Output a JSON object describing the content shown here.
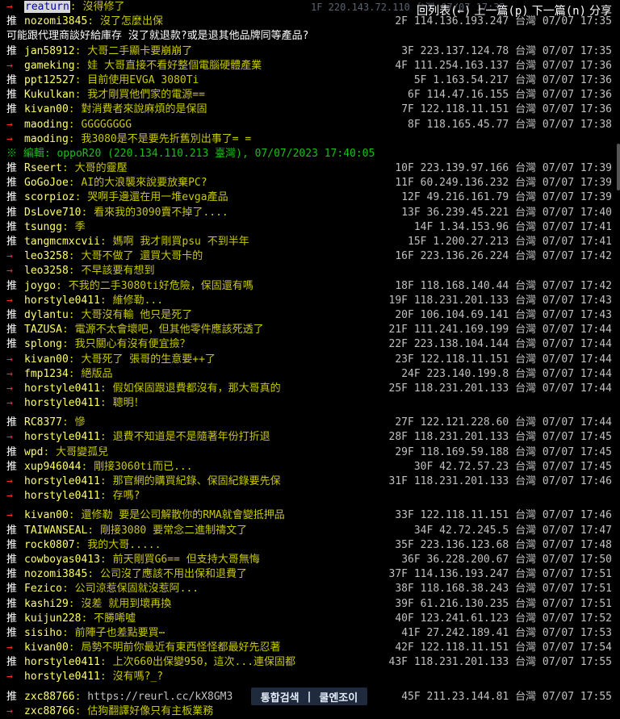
{
  "nav": {
    "back": "回列表(←)",
    "prev": "上一篇(p)",
    "next": "下一篇(n)",
    "share": "分享"
  },
  "faded_header": "1F 220.143.72.110 台灣 07/07 17:35",
  "body_line": "可能跟代理商談好給庫存 沒了就退款?或是退其他品牌同等產品?",
  "edit_line": "※ 編輯: oppoR20 (220.134.110.213 臺灣), 07/07/2023 17:40:05",
  "comments_a": [
    {
      "tag": "→",
      "type": "arrow",
      "user": "reaturn",
      "hl": true,
      "content": "沒得修了",
      "meta": ""
    },
    {
      "tag": "推",
      "type": "push",
      "user": "nozomi3845",
      "content": "沒了怎麼出保",
      "meta": "2F 114.136.193.247 台灣 07/07 17:35"
    }
  ],
  "comments_b": [
    {
      "tag": "推",
      "type": "push",
      "user": "jan58912",
      "content": "大哥二手顯卡要崩崩了",
      "meta": "3F 223.137.124.78 台灣 07/07 17:35"
    },
    {
      "tag": "→",
      "type": "arrow",
      "user": "gameking",
      "content": "娃 大哥直接不看好整個電腦硬體產業",
      "meta": "4F 111.254.163.137 台灣 07/07 17:36"
    },
    {
      "tag": "推",
      "type": "push",
      "user": "ppt12527",
      "content": "目前使用EVGA 3080Ti",
      "meta": "5F 1.163.54.217 台灣 07/07 17:36"
    },
    {
      "tag": "推",
      "type": "push",
      "user": "Kukulkan",
      "content": "我才剛買他們家的電源==",
      "meta": "6F 114.47.16.155 台灣 07/07 17:36"
    },
    {
      "tag": "推",
      "type": "push",
      "user": "kivan00",
      "content": "對消費者來說麻煩的是保固",
      "meta": "7F 122.118.11.151 台灣 07/07 17:36"
    },
    {
      "tag": "→",
      "type": "arrow",
      "user": "maoding",
      "content": "GGGGGGGG",
      "meta": "8F 118.165.45.77 台灣 07/07 17:38"
    },
    {
      "tag": "→",
      "type": "arrow",
      "user": "maoding",
      "content": "我3080是不是要先折舊別出事了= =",
      "meta": ""
    }
  ],
  "comments_c": [
    {
      "tag": "推",
      "type": "push",
      "user": "Rseert",
      "content": "大哥的靈壓",
      "meta": "10F 223.139.97.166 台灣 07/07 17:39"
    },
    {
      "tag": "推",
      "type": "push",
      "user": "GoGoJoe",
      "content": "AI的大浪襲來說要放棄PC?",
      "meta": "11F 60.249.136.232 台灣 07/07 17:39"
    },
    {
      "tag": "推",
      "type": "push",
      "user": "scorpioz",
      "content": "哭啊手邊還在用一堆evga產品",
      "meta": "12F 49.216.161.79 台灣 07/07 17:39"
    },
    {
      "tag": "推",
      "type": "push",
      "user": "DsLove710",
      "content": "看來我的3090賣不掉了....",
      "meta": "13F 36.239.45.221 台灣 07/07 17:40"
    },
    {
      "tag": "推",
      "type": "push",
      "user": "tsungg",
      "content": "季",
      "meta": "14F 1.34.153.96 台灣 07/07 17:41"
    },
    {
      "tag": "推",
      "type": "push",
      "user": "tangmcmxcvii",
      "content": "媽啊 我才剛買psu 不到半年",
      "meta": "15F 1.200.27.213 台灣 07/07 17:41"
    },
    {
      "tag": "→",
      "type": "arrow",
      "user": "leo3258",
      "content": "大哥不做了 還買大哥卡的",
      "meta": "16F 223.136.26.224 台灣 07/07 17:42"
    },
    {
      "tag": "→",
      "type": "arrow",
      "user": "leo3258",
      "content": "不早該要有想到",
      "meta": ""
    },
    {
      "tag": "推",
      "type": "push",
      "user": "joygo",
      "content": "不我的二手3080ti好危險，保固還有嗎",
      "meta": "18F 118.168.140.44 台灣 07/07 17:42"
    },
    {
      "tag": "→",
      "type": "arrow",
      "user": "horstyle0411",
      "content": "維修勒...",
      "meta": "19F 118.231.201.133 台灣 07/07 17:43"
    },
    {
      "tag": "推",
      "type": "push",
      "user": "dylantu",
      "content": "大哥沒有輸 他只是死了",
      "meta": "20F 106.104.69.141 台灣 07/07 17:43"
    },
    {
      "tag": "推",
      "type": "push",
      "user": "TAZUSA",
      "content": "電源不太會壞吧，但其他零件應該死透了",
      "meta": "21F 111.241.169.199 台灣 07/07 17:44"
    },
    {
      "tag": "推",
      "type": "push",
      "user": "splong",
      "content": "我只關心有沒有便宜撿？",
      "meta": "22F 223.138.104.144 台灣 07/07 17:44"
    },
    {
      "tag": "→",
      "type": "arrow",
      "user": "kivan00",
      "content": "大哥死了 張哥的生意要++了",
      "meta": "23F 122.118.11.151 台灣 07/07 17:44"
    },
    {
      "tag": "→",
      "type": "arrow",
      "user": "fmp1234",
      "content": "絕版品",
      "meta": "24F 223.140.199.8 台灣 07/07 17:44"
    },
    {
      "tag": "→",
      "type": "arrow",
      "user": "horstyle0411",
      "content": "假如保固跟退費都沒有，那大哥真的",
      "meta": "25F 118.231.201.133 台灣 07/07 17:44"
    },
    {
      "tag": "→",
      "type": "arrow",
      "user": "horstyle0411",
      "content": "聰明！",
      "meta": ""
    }
  ],
  "comments_d": [
    {
      "tag": "推",
      "type": "push",
      "user": "RC8377",
      "content": "慘",
      "meta": "27F 122.121.228.60 台灣 07/07 17:44"
    },
    {
      "tag": "→",
      "type": "arrow",
      "user": "horstyle0411",
      "content": "退費不知道是不是隨著年份打折退",
      "meta": "28F 118.231.201.133 台灣 07/07 17:45"
    },
    {
      "tag": "推",
      "type": "push",
      "user": "wpd",
      "content": "大哥變孤兒",
      "meta": "29F 118.169.59.188 台灣 07/07 17:45"
    },
    {
      "tag": "推",
      "type": "push",
      "user": "xup946044",
      "content": "剛接3060ti而已...",
      "meta": "30F 42.72.57.23 台灣 07/07 17:45"
    },
    {
      "tag": "→",
      "type": "arrow",
      "user": "horstyle0411",
      "content": "那官網的購買紀錄、保固紀錄要先保",
      "meta": "31F 118.231.201.133 台灣 07/07 17:46"
    },
    {
      "tag": "→",
      "type": "arrow",
      "user": "horstyle0411",
      "content": "存嗎?",
      "meta": ""
    }
  ],
  "comments_e": [
    {
      "tag": "→",
      "type": "arrow",
      "user": "kivan00",
      "content": "還修勒 要是公司解散你的RMA就會變抵押品",
      "meta": "33F 122.118.11.151 台灣 07/07 17:46"
    },
    {
      "tag": "推",
      "type": "push",
      "user": "TAIWANSEAL",
      "content": "剛接3080 要常念二進制禱文了",
      "meta": "34F 42.72.245.5 台灣 07/07 17:47"
    },
    {
      "tag": "推",
      "type": "push",
      "user": "rock0807",
      "content": "我的大哥.....",
      "meta": "35F 223.136.123.68 台灣 07/07 17:48"
    },
    {
      "tag": "推",
      "type": "push",
      "user": "cowboyas0413",
      "content": "前天剛買G6== 但支持大哥無悔",
      "meta": "36F 36.228.200.67 台灣 07/07 17:50"
    },
    {
      "tag": "推",
      "type": "push",
      "user": "nozomi3845",
      "content": "公司沒了應該不用出保和退費了",
      "meta": "37F 114.136.193.247 台灣 07/07 17:51"
    },
    {
      "tag": "推",
      "type": "push",
      "user": "Fezico",
      "content": "公司涼惹保固就沒惹阿...",
      "meta": "38F 118.168.38.243 台灣 07/07 17:51"
    },
    {
      "tag": "推",
      "type": "push",
      "user": "kashi29",
      "content": "沒差 就用到壞再換",
      "meta": "39F 61.216.130.235 台灣 07/07 17:51"
    },
    {
      "tag": "推",
      "type": "push",
      "user": "kuijun228",
      "content": "不勝唏噓",
      "meta": "40F 123.241.61.123 台灣 07/07 17:52"
    },
    {
      "tag": "推",
      "type": "push",
      "user": "sisiho",
      "content": "前陣子也差點要買⋯",
      "meta": "41F 27.242.189.41 台灣 07/07 17:53"
    },
    {
      "tag": "→",
      "type": "arrow",
      "user": "kivan00",
      "content": "局勢不明前你最近有東西怪怪都最好先忍著",
      "meta": "42F 122.118.11.151 台灣 07/07 17:54"
    },
    {
      "tag": "推",
      "type": "push",
      "user": "horstyle0411",
      "content": "上次660出保變950，這次...連保固都",
      "meta": "43F 118.231.201.133 台灣 07/07 17:55"
    },
    {
      "tag": "→",
      "type": "arrow",
      "user": "horstyle0411",
      "content": "沒有嗎?_?",
      "meta": ""
    }
  ],
  "comments_f": [
    {
      "tag": "推",
      "type": "push",
      "user": "zxc88766",
      "content": "",
      "link": "https://reurl.cc/kX8GM3",
      "meta": "45F 211.23.144.81 台灣 07/07 17:55"
    },
    {
      "tag": "→",
      "type": "arrow",
      "user": "zxc88766",
      "content": "估狗翻譯好像只有主板業務",
      "meta": ""
    }
  ],
  "bottom_bar": {
    "left": "통합검색",
    "sep": "|",
    "right": "쿨엔조이"
  }
}
